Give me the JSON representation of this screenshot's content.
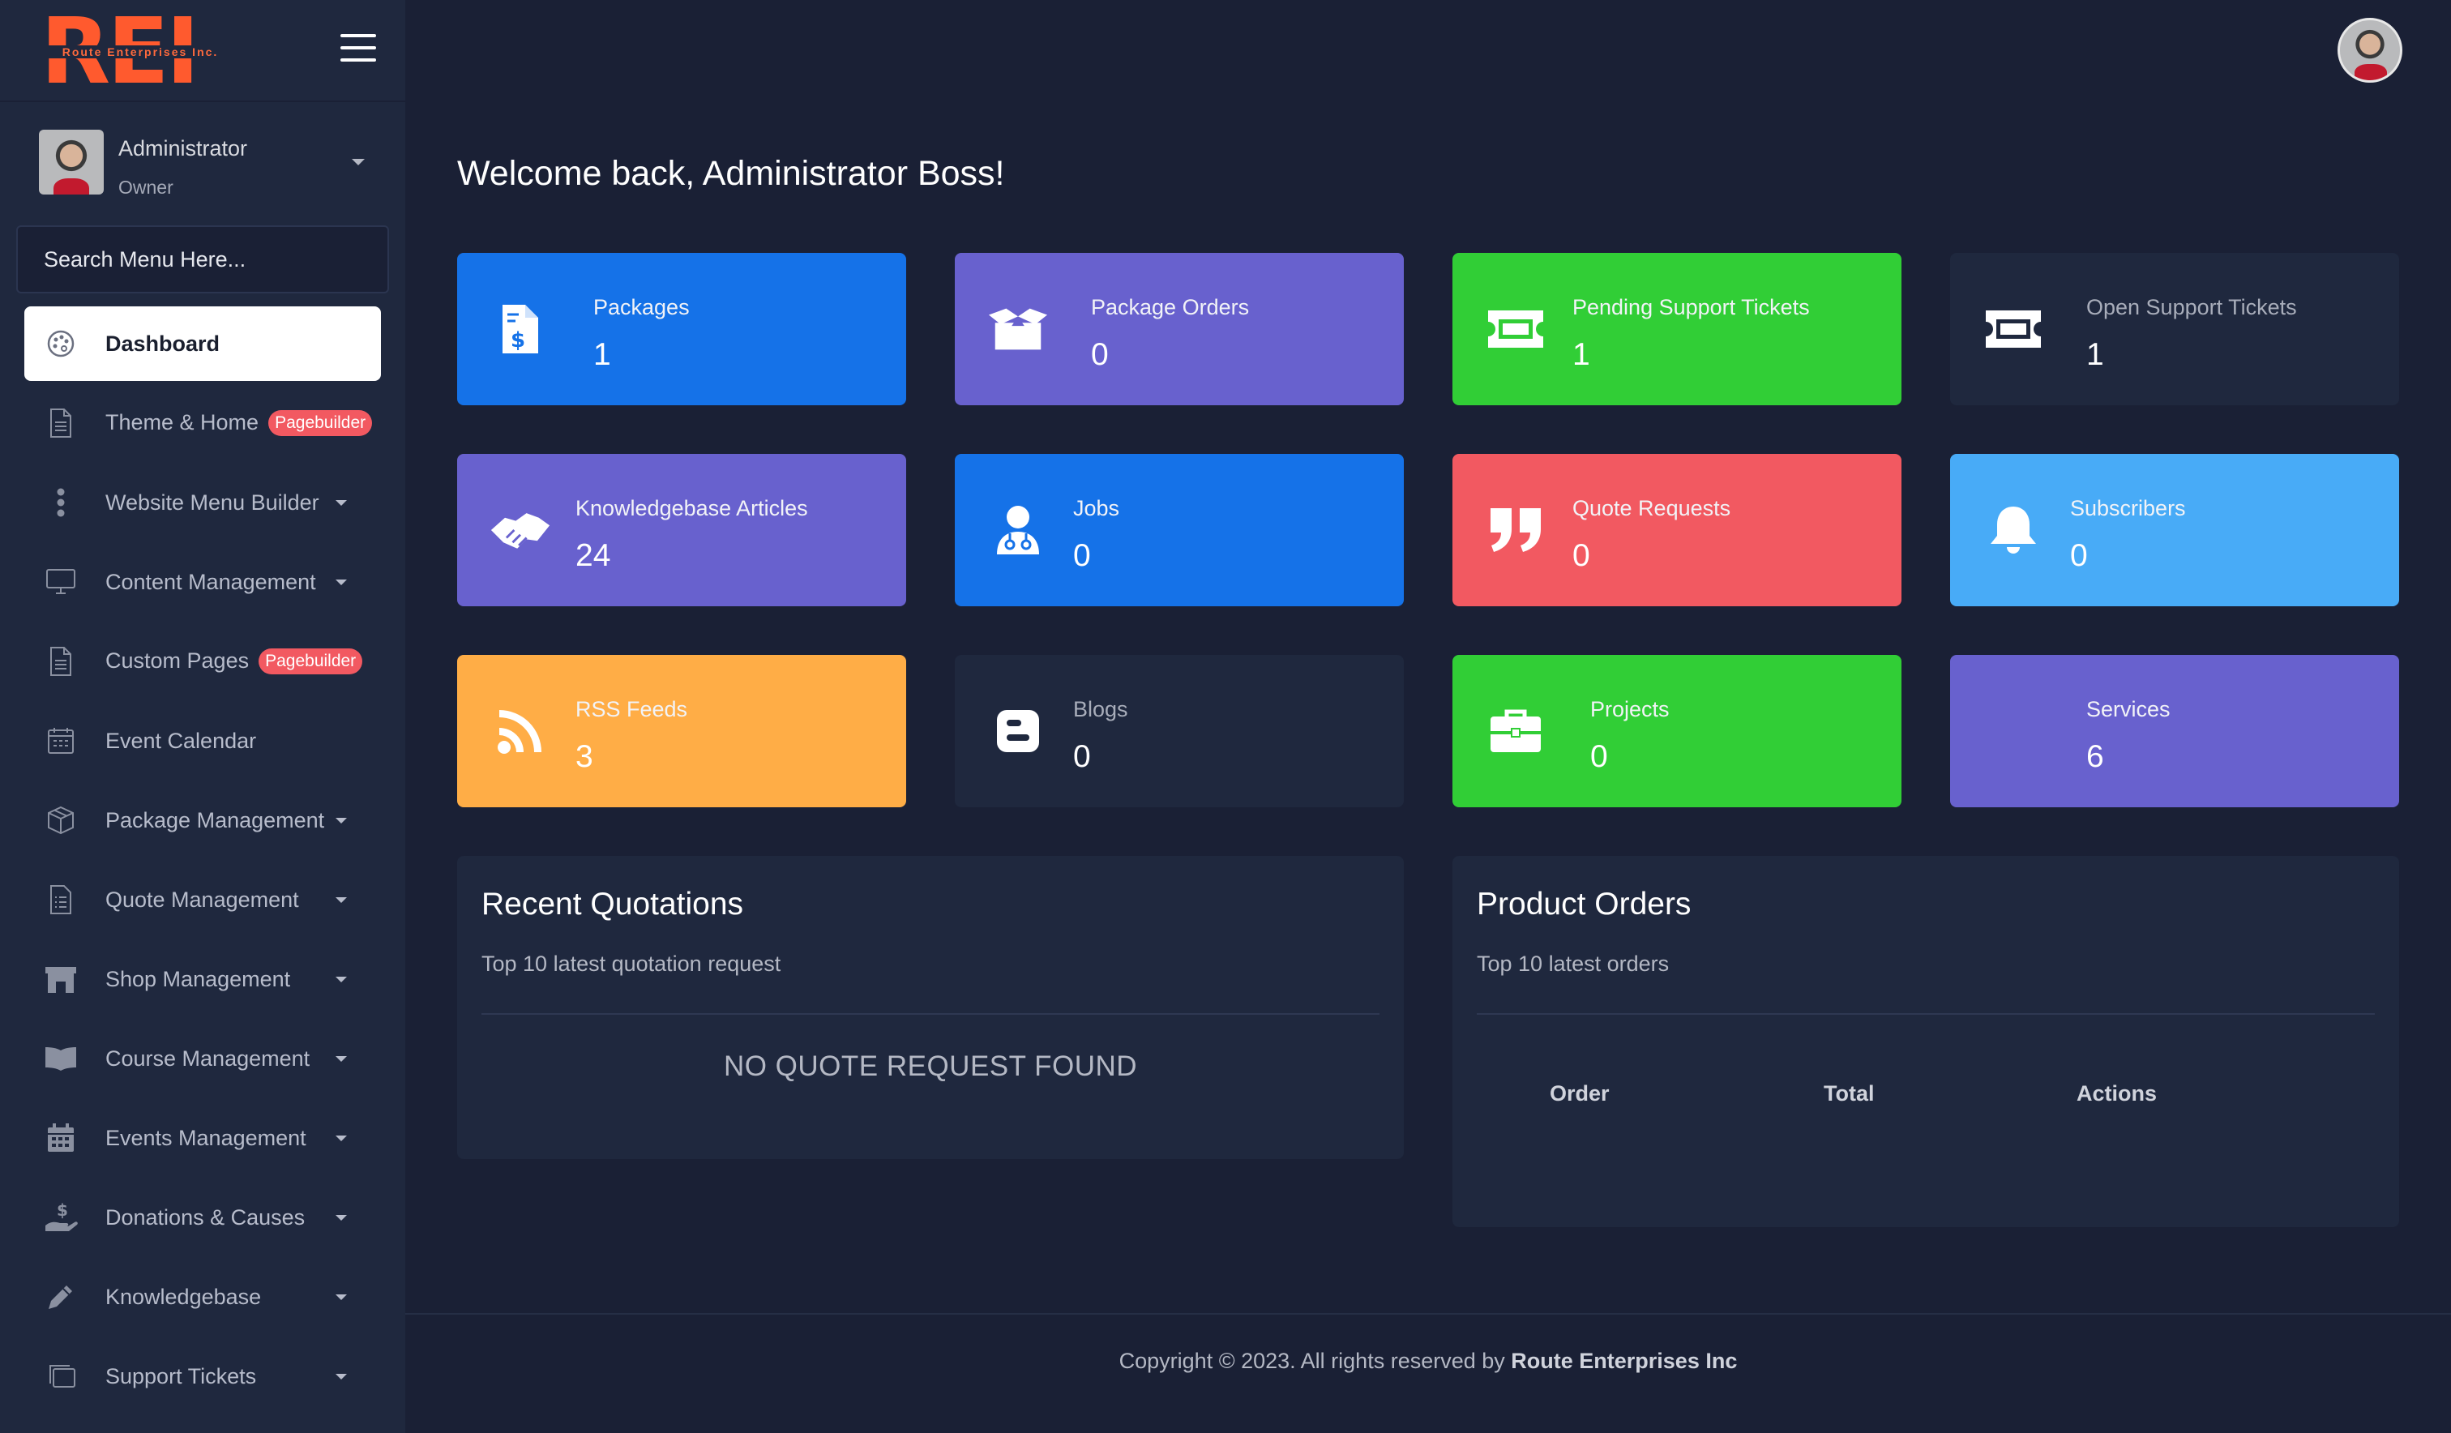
{
  "brand": {
    "logo_text": "REI",
    "logo_tagline": "Route Enterprises Inc."
  },
  "user": {
    "name": "Administrator",
    "role": "Owner"
  },
  "search": {
    "placeholder": "Search Menu Here..."
  },
  "sidebar": {
    "items": [
      {
        "label": "Dashboard",
        "icon": "palette-icon",
        "active": true
      },
      {
        "label": "Theme & Home",
        "icon": "document-icon",
        "badge": "Pagebuilder"
      },
      {
        "label": "Website Menu Builder",
        "icon": "vertical-dots-icon"
      },
      {
        "label": "Content Management",
        "icon": "monitor-icon"
      },
      {
        "label": "Custom Pages",
        "icon": "document-icon",
        "badge": "Pagebuilder"
      },
      {
        "label": "Event Calendar",
        "icon": "calendar-grid-icon"
      },
      {
        "label": "Package Management",
        "icon": "package-icon"
      },
      {
        "label": "Quote Management",
        "icon": "document-list-icon"
      },
      {
        "label": "Shop Management",
        "icon": "store-icon"
      },
      {
        "label": "Course Management",
        "icon": "book-icon"
      },
      {
        "label": "Events Management",
        "icon": "calendar-icon"
      },
      {
        "label": "Donations & Causes",
        "icon": "hand-dollar-icon"
      },
      {
        "label": "Knowledgebase",
        "icon": "pencil-icon"
      },
      {
        "label": "Support Tickets",
        "icon": "copy-icon"
      }
    ]
  },
  "main": {
    "welcome": "Welcome back, Administrator Boss!",
    "cards": [
      {
        "title": "Packages",
        "value": "1",
        "color": "#1572e8",
        "icon": "file-dollar-icon"
      },
      {
        "title": "Package Orders",
        "value": "0",
        "color": "#6861ce",
        "icon": "open-box-icon"
      },
      {
        "title": "Pending Support Tickets",
        "value": "1",
        "color": "#31ce36",
        "icon": "ticket-icon"
      },
      {
        "title": "Open Support Tickets",
        "value": "1",
        "color": "#1f283e",
        "icon": "ticket-icon"
      },
      {
        "title": "Knowledgebase Articles",
        "value": "24",
        "color": "#6861ce",
        "icon": "handshake-icon"
      },
      {
        "title": "Jobs",
        "value": "0",
        "color": "#1572e8",
        "icon": "user-doctor-icon"
      },
      {
        "title": "Quote Requests",
        "value": "0",
        "color": "#f25961",
        "icon": "quote-icon"
      },
      {
        "title": "Subscribers",
        "value": "0",
        "color": "#48abf7",
        "icon": "bell-icon"
      },
      {
        "title": "RSS Feeds",
        "value": "3",
        "color": "#ffad46",
        "icon": "rss-icon"
      },
      {
        "title": "Blogs",
        "value": "0",
        "color": "#1f283e",
        "icon": "blogger-icon"
      },
      {
        "title": "Projects",
        "value": "0",
        "color": "#31ce36",
        "icon": "briefcase-icon"
      },
      {
        "title": "Services",
        "value": "6",
        "color": "#6861ce",
        "icon": "none"
      }
    ],
    "recent_quotations": {
      "title": "Recent Quotations",
      "subtitle": "Top 10 latest quotation request",
      "empty": "NO QUOTE REQUEST FOUND"
    },
    "product_orders": {
      "title": "Product Orders",
      "subtitle": "Top 10 latest orders",
      "columns": [
        "Order",
        "Total",
        "Actions"
      ]
    }
  },
  "footer": {
    "text": "Copyright © 2023. All rights reserved by",
    "company": "Route Enterprises Inc"
  }
}
